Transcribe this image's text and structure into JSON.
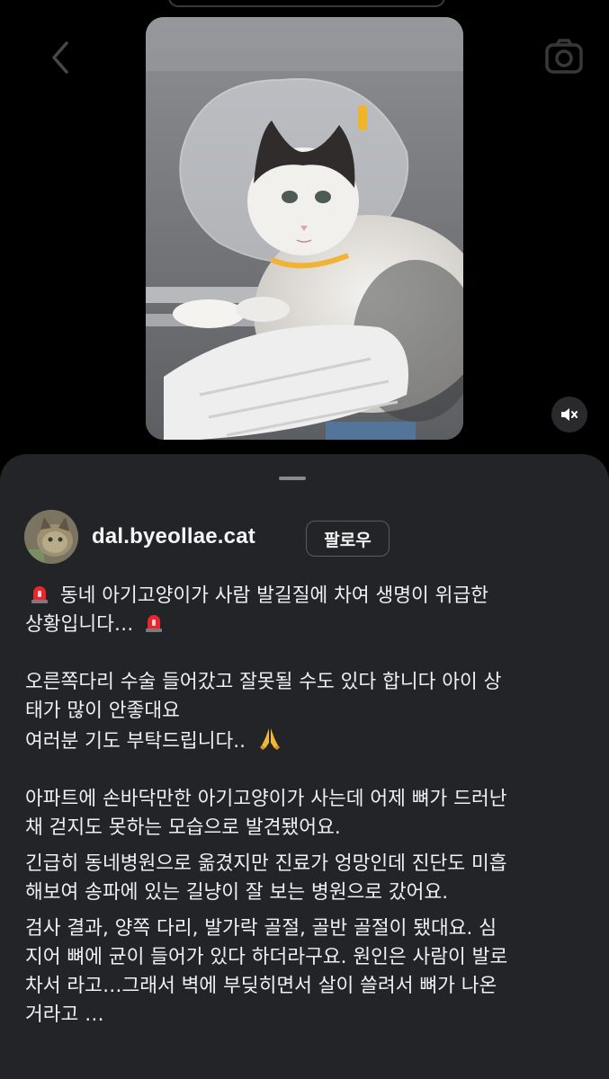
{
  "nav": {
    "back_icon": "chevron-left-icon",
    "camera_icon": "camera-icon"
  },
  "media": {
    "description_icon": "kitten-photo",
    "mute_icon": "speaker-muted-icon"
  },
  "post": {
    "username": "dal.byeollae.cat",
    "follow_label": "팔로우",
    "lines": {
      "l1a": "동네 아기고양이가 사람 발길질에 차여 생명이 위급한",
      "l1b": "상황입니다…",
      "l2a": "오른쪽다리 수술 들어갔고 잘못될 수도 있다 합니다 아이 상",
      "l2b": "태가 많이 안좋대요",
      "l3": "여러분 기도 부탁드립니다..",
      "l4a": "아파트에 손바닥만한 아기고양이가 사는데 어제 뼈가 드러난",
      "l4b": "채 걷지도 못하는 모습으로 발견됐어요.",
      "l5a": "긴급히 동네병원으로 옮겼지만 진료가 엉망인데 진단도 미흡",
      "l5b": "해보여 송파에 있는 길냥이 잘 보는 병원으로 갔어요.",
      "l6a": "검사 결과, 양쪽 다리, 발가락 골절, 골반 골절이 됐대요. 심",
      "l6b": "지어 뼈에 균이 들어가 있다 하더라구요. 원인은 사람이 발로",
      "l6c": "차서 라고…그래서 벽에 부딪히면서 살이 쓸려서 뼈가 나온",
      "l6d": "거라고 …"
    }
  },
  "colors": {
    "sheet_bg": "#222428",
    "text": "#f0f0f0",
    "siren_red": "#e8262d"
  }
}
